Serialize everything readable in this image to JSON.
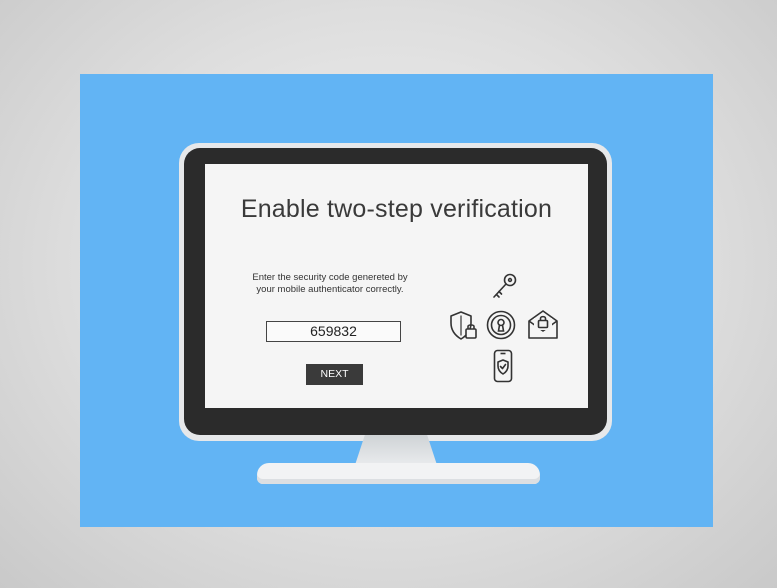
{
  "screen": {
    "title": "Enable two-step verification",
    "instruction_line1": "Enter the security code genereted by",
    "instruction_line2": "your mobile authenticator correctly.",
    "code_value": "659832",
    "next_label": "NEXT"
  },
  "icons": [
    "key-icon",
    "shield-lock-icon",
    "keyhole-icon",
    "envelope-lock-icon",
    "phone-shield-icon"
  ],
  "colors": {
    "background": "#62b4f4",
    "bezel": "#2b2b2b",
    "screen": "#f5f5f5",
    "button": "#3a3a3a"
  }
}
